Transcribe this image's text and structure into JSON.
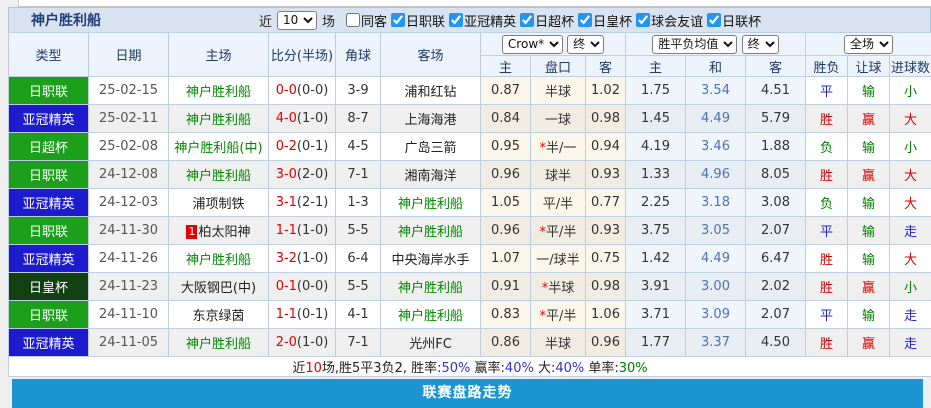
{
  "header": {
    "team_title": "神户胜利船",
    "recent_label": "近",
    "recent_count": "10",
    "matches_label": "场",
    "checkboxes": [
      {
        "label": "同客",
        "checked": false
      },
      {
        "label": "日职联",
        "checked": true
      },
      {
        "label": "亚冠精英",
        "checked": true
      },
      {
        "label": "日超杯",
        "checked": true
      },
      {
        "label": "日皇杯",
        "checked": true
      },
      {
        "label": "球会友谊",
        "checked": true
      },
      {
        "label": "日联杯",
        "checked": true
      }
    ],
    "checkbox_accent_color": "#2196F3"
  },
  "table": {
    "columns": [
      "类型",
      "日期",
      "主场",
      "比分(半场)",
      "角球",
      "客场"
    ],
    "group_selects": {
      "crow": "Crow*",
      "crow_stage": "终",
      "odds_avg": "胜平负均值",
      "odds_stage": "终",
      "scope": "全场"
    },
    "sub_columns": [
      "主",
      "盘口",
      "客",
      "主",
      "和",
      "客",
      "胜负",
      "让球",
      "进球数"
    ],
    "league_colors": {
      "日职联": "#1CA01C",
      "亚冠精英": "#1C1CCE",
      "日超杯": "#1CA01C",
      "日皇杯": "#114111"
    },
    "rows": [
      {
        "type": "日职联",
        "date": "25-02-15",
        "home": "神户胜利船",
        "home_self": true,
        "home_badge": "",
        "score_ft": "0-0",
        "score_ht": "(0-0)",
        "corner": "3-9",
        "away": "浦和红钻",
        "away_self": false,
        "crow_home": "0.87",
        "handicap_star": "",
        "handicap": "半球",
        "crow_away": "1.02",
        "odds_home": "1.75",
        "odds_draw": "3.54",
        "odds_away": "4.51",
        "result": "平",
        "handicap_result": "输",
        "goals_result": "小"
      },
      {
        "type": "亚冠精英",
        "date": "25-02-11",
        "home": "神户胜利船",
        "home_self": true,
        "home_badge": "",
        "score_ft": "4-0",
        "score_ht": "(1-0)",
        "corner": "8-7",
        "away": "上海海港",
        "away_self": false,
        "crow_home": "0.84",
        "handicap_star": "",
        "handicap": "一球",
        "crow_away": "0.98",
        "odds_home": "1.45",
        "odds_draw": "4.49",
        "odds_away": "5.79",
        "result": "胜",
        "handicap_result": "赢",
        "goals_result": "大"
      },
      {
        "type": "日超杯",
        "date": "25-02-08",
        "home": "神户胜利船(中)",
        "home_self": true,
        "home_badge": "",
        "score_ft": "0-2",
        "score_ht": "(0-1)",
        "corner": "4-5",
        "away": "广岛三箭",
        "away_self": false,
        "crow_home": "0.95",
        "handicap_star": "*",
        "handicap": "半/一",
        "crow_away": "0.94",
        "odds_home": "4.19",
        "odds_draw": "3.46",
        "odds_away": "1.88",
        "result": "负",
        "handicap_result": "输",
        "goals_result": "小"
      },
      {
        "type": "日职联",
        "date": "24-12-08",
        "home": "神户胜利船",
        "home_self": true,
        "home_badge": "",
        "score_ft": "3-0",
        "score_ht": "(2-0)",
        "corner": "7-1",
        "away": "湘南海洋",
        "away_self": false,
        "crow_home": "0.96",
        "handicap_star": "",
        "handicap": "球半",
        "crow_away": "0.93",
        "odds_home": "1.33",
        "odds_draw": "4.96",
        "odds_away": "8.05",
        "result": "胜",
        "handicap_result": "赢",
        "goals_result": "大"
      },
      {
        "type": "亚冠精英",
        "date": "24-12-03",
        "home": "浦项制铁",
        "home_self": false,
        "home_badge": "",
        "score_ft": "3-1",
        "score_ht": "(2-1)",
        "corner": "1-3",
        "away": "神户胜利船",
        "away_self": true,
        "crow_home": "1.05",
        "handicap_star": "",
        "handicap": "平/半",
        "crow_away": "0.77",
        "odds_home": "2.25",
        "odds_draw": "3.18",
        "odds_away": "3.08",
        "result": "负",
        "handicap_result": "输",
        "goals_result": "大"
      },
      {
        "type": "日职联",
        "date": "24-11-30",
        "home": "柏太阳神",
        "home_self": false,
        "home_badge": "1",
        "score_ft": "1-1",
        "score_ht": "(1-0)",
        "corner": "5-5",
        "away": "神户胜利船",
        "away_self": true,
        "crow_home": "0.96",
        "handicap_star": "*",
        "handicap": "平/半",
        "crow_away": "0.93",
        "odds_home": "3.75",
        "odds_draw": "3.05",
        "odds_away": "2.07",
        "result": "平",
        "handicap_result": "输",
        "goals_result": "走"
      },
      {
        "type": "亚冠精英",
        "date": "24-11-26",
        "home": "神户胜利船",
        "home_self": true,
        "home_badge": "",
        "score_ft": "3-2",
        "score_ht": "(1-0)",
        "corner": "6-4",
        "away": "中央海岸水手",
        "away_self": false,
        "crow_home": "1.07",
        "handicap_star": "",
        "handicap": "一/球半",
        "crow_away": "0.75",
        "odds_home": "1.42",
        "odds_draw": "4.49",
        "odds_away": "6.47",
        "result": "胜",
        "handicap_result": "输",
        "goals_result": "大"
      },
      {
        "type": "日皇杯",
        "date": "24-11-23",
        "home": "大阪钢巴(中)",
        "home_self": false,
        "home_badge": "",
        "score_ft": "0-1",
        "score_ht": "(0-0)",
        "corner": "5-5",
        "away": "神户胜利船",
        "away_self": true,
        "crow_home": "0.91",
        "handicap_star": "*",
        "handicap": "半球",
        "crow_away": "0.98",
        "odds_home": "3.91",
        "odds_draw": "3.00",
        "odds_away": "2.02",
        "result": "胜",
        "handicap_result": "赢",
        "goals_result": "小"
      },
      {
        "type": "日职联",
        "date": "24-11-10",
        "home": "东京绿茵",
        "home_self": false,
        "home_badge": "",
        "score_ft": "1-1",
        "score_ht": "(0-1)",
        "corner": "4-1",
        "away": "神户胜利船",
        "away_self": true,
        "crow_home": "0.83",
        "handicap_star": "*",
        "handicap": "平/半",
        "crow_away": "1.06",
        "odds_home": "3.71",
        "odds_draw": "3.09",
        "odds_away": "2.07",
        "result": "平",
        "handicap_result": "输",
        "goals_result": "走"
      },
      {
        "type": "亚冠精英",
        "date": "24-11-05",
        "home": "神户胜利船",
        "home_self": true,
        "home_badge": "",
        "score_ft": "2-0",
        "score_ht": "(1-0)",
        "corner": "7-1",
        "away": "光州FC",
        "away_self": false,
        "crow_home": "0.86",
        "handicap_star": "",
        "handicap": "半球",
        "crow_away": "0.96",
        "odds_home": "1.77",
        "odds_draw": "3.37",
        "odds_away": "4.50",
        "result": "胜",
        "handicap_result": "赢",
        "goals_result": "走"
      }
    ],
    "result_colors": {
      "胜": "#D40000",
      "赢": "#D40000",
      "大": "#D40000",
      "平": "#2323CC",
      "走": "#2323CC",
      "负": "#008000",
      "输": "#008000",
      "小": "#008000"
    },
    "summary_segments": [
      {
        "text": "近",
        "color": "black"
      },
      {
        "text": "10",
        "color": "red"
      },
      {
        "text": "场,胜5平3负2, 胜率:",
        "color": "black"
      },
      {
        "text": "50%",
        "color": "blue"
      },
      {
        "text": " 赢率:",
        "color": "black"
      },
      {
        "text": "40%",
        "color": "blue"
      },
      {
        "text": " 大:",
        "color": "black"
      },
      {
        "text": "40%",
        "color": "blue"
      },
      {
        "text": " 单率:",
        "color": "black"
      },
      {
        "text": "30%",
        "color": "green"
      }
    ]
  },
  "footer": {
    "bottom_bar": "联赛盘路走势",
    "bottom_bar_color": "#1C96D3"
  }
}
